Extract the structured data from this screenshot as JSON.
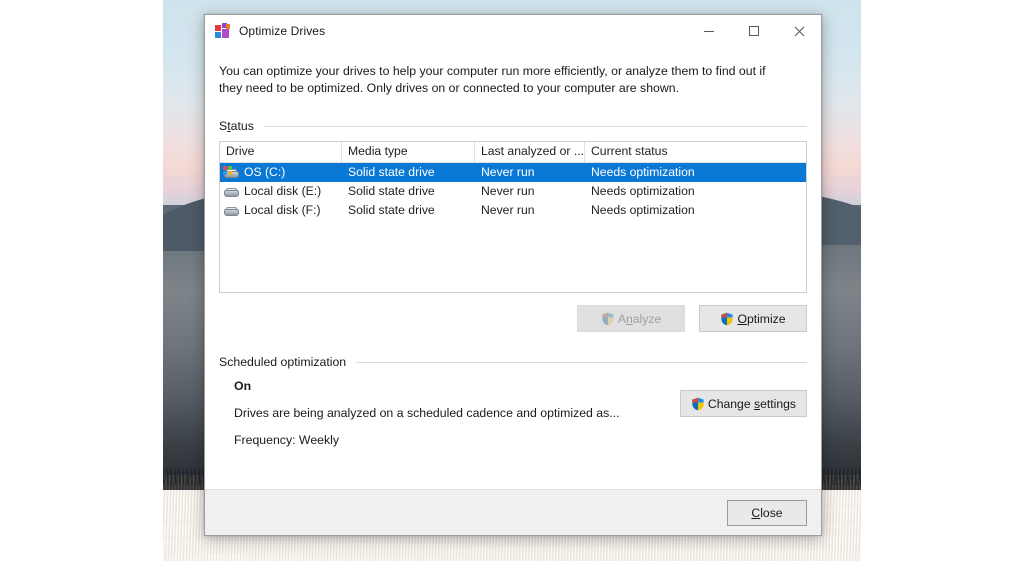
{
  "window": {
    "title": "Optimize Drives",
    "icon": "defrag-icon",
    "controls": {
      "minimize": "Minimize",
      "maximize": "Maximize",
      "close": "Close"
    }
  },
  "intro": {
    "text": "You can optimize your drives to help your computer run more efficiently, or analyze them to find out if they need to be optimized. Only drives on or connected to your computer are shown."
  },
  "status_section": {
    "label_prefix": "S",
    "label_accesskey": "t",
    "label_suffix": "atus",
    "label_full": "Status"
  },
  "drives_table": {
    "columns": [
      "Drive",
      "Media type",
      "Last analyzed or ...",
      "Current status"
    ],
    "rows": [
      {
        "drive": "OS (C:)",
        "media": "Solid state drive",
        "last": "Never run",
        "status": "Needs optimization",
        "selected": true,
        "icon": "system-drive-icon"
      },
      {
        "drive": "Local disk (E:)",
        "media": "Solid state drive",
        "last": "Never run",
        "status": "Needs optimization",
        "selected": false,
        "icon": "drive-icon"
      },
      {
        "drive": "Local disk (F:)",
        "media": "Solid state drive",
        "last": "Never run",
        "status": "Needs optimization",
        "selected": false,
        "icon": "drive-icon"
      }
    ]
  },
  "actions": {
    "analyze": {
      "prefix": "A",
      "accesskey": "n",
      "suffix": "alyze",
      "full": "Analyze",
      "enabled": false
    },
    "optimize": {
      "prefix": "",
      "accesskey": "O",
      "suffix": "ptimize",
      "full": "Optimize",
      "enabled": true
    }
  },
  "scheduled_section": {
    "heading": "Scheduled optimization",
    "state": "On",
    "description": "Drives are being analyzed on a scheduled cadence and optimized as...",
    "frequency": "Frequency: Weekly",
    "change_button": {
      "prefix": "Change ",
      "accesskey": "s",
      "suffix": "ettings",
      "full": "Change settings"
    }
  },
  "footer": {
    "close_button": {
      "prefix": "",
      "accesskey": "C",
      "suffix": "lose",
      "full": "Close"
    }
  },
  "colors": {
    "accent_selection": "#0a79d5",
    "window_bg": "#ffffff",
    "footer_bg": "#f0f0f0",
    "button_bg": "#e6e6e6",
    "text": "#1a1a1a"
  }
}
